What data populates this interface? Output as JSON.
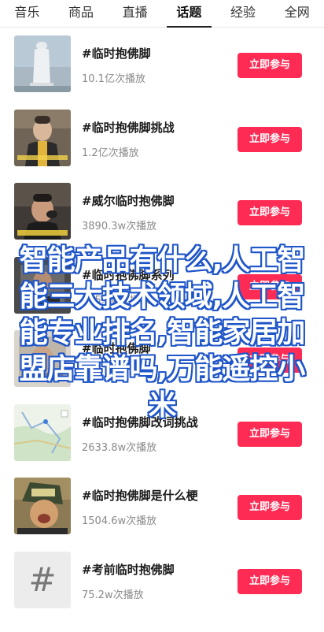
{
  "tabs": [
    {
      "label": "音乐",
      "active": false
    },
    {
      "label": "商品",
      "active": false
    },
    {
      "label": "直播",
      "active": false
    },
    {
      "label": "话题",
      "active": true
    },
    {
      "label": "经验",
      "active": false
    },
    {
      "label": "全网",
      "active": false
    }
  ],
  "items": [
    {
      "title": "#临时抱佛脚",
      "plays": "10.1亿次播放",
      "button": "立即参与",
      "thumb": "buddha-statue"
    },
    {
      "title": "#临时抱佛脚挑战",
      "plays": "1.2亿次播放",
      "button": "立即参与",
      "thumb": "man-speaking"
    },
    {
      "title": "#威尔临时抱佛脚",
      "plays": "3890.3w次播放",
      "button": "立即参与",
      "thumb": "man-microphone"
    },
    {
      "title": "#临时抱佛脚系列",
      "plays": "105.7w次播放",
      "button": "立即参与",
      "thumb": "video-still"
    },
    {
      "title": "#临时抱佛脚",
      "plays": "",
      "button": "立即参与",
      "thumb": "video-still"
    },
    {
      "title": "#临时抱佛脚改词挑战",
      "plays": "2633.8w次播放",
      "button": "立即参与",
      "thumb": "map"
    },
    {
      "title": "#临时抱佛脚是什么梗",
      "plays": "1504.6w次播放",
      "button": "立即参与",
      "thumb": "man-hat"
    },
    {
      "title": "#考前临时抱佛脚",
      "plays": "75.2w次播放",
      "button": "立即参与",
      "thumb": "hash"
    }
  ],
  "watermark": "智能产品有什么,人工智能三大技术领域,人工智能专业排名,智能家居加盟店靠谱吗,万能遥控小米",
  "colors": {
    "accent": "#fe2c55",
    "watermark_outline": "#1e55c8"
  }
}
